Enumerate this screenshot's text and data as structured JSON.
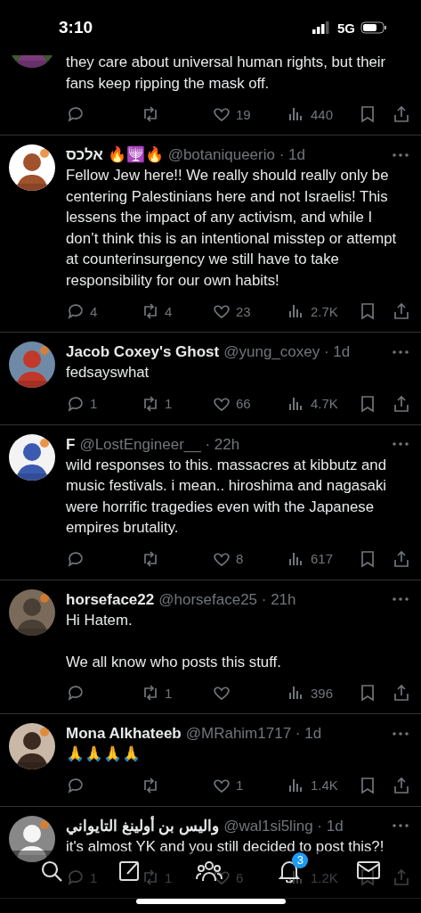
{
  "status_bar": {
    "time": "3:10",
    "network": "5G"
  },
  "tweets": [
    {
      "text": "they care about universal human rights, but their fans keep ripping the mask off.",
      "stats": {
        "likes": "19",
        "views": "440"
      }
    },
    {
      "name": "🔥🕎🔥 אלכס",
      "meta": "@botaniqueerio · 1d",
      "text": "Fellow Jew here!! We really should really only be centering Palestinians here and not Israelis! This lessens the impact of any activism, and while I don’t think this is an intentional misstep or attempt at counterinsurgency we still have to take responsibility for our own habits!",
      "stats": {
        "replies": "4",
        "reposts": "4",
        "likes": "23",
        "views": "2.7K"
      }
    },
    {
      "name": "Jacob Coxey's Ghost",
      "meta": "@yung_coxey · 1d",
      "text": "fedsayswhat",
      "stats": {
        "replies": "1",
        "reposts": "1",
        "likes": "66",
        "views": "4.7K"
      }
    },
    {
      "name": "F",
      "meta": "@LostEngineer__ · 22h",
      "text": "wild responses to this. massacres at kibbutz and music festivals. i mean.. hiroshima and nagasaki were horrific tragedies even with the Japanese empires brutality.",
      "stats": {
        "likes": "8",
        "views": "617"
      }
    },
    {
      "name": "horseface22",
      "meta": "@horseface25 · 21h",
      "text": "Hi Hatem.\n\nWe all know who posts this stuff.",
      "stats": {
        "reposts": "1",
        "views": "396"
      }
    },
    {
      "name": "Mona Alkhateeb",
      "meta": "@MRahim1717 · 1d",
      "text": "🙏🙏🙏🙏",
      "stats": {
        "likes": "1",
        "views": "1.4K"
      }
    },
    {
      "name": "واليس بن أولينغ التايواني",
      "meta": "@wal1si5ling · 1d",
      "text": "it's almost YK and you still decided to post this?!",
      "stats": {
        "replies": "1",
        "reposts": "1",
        "likes": "6",
        "views": "1.2K"
      }
    }
  ],
  "tab_bar": {
    "notifications_badge": "3"
  }
}
